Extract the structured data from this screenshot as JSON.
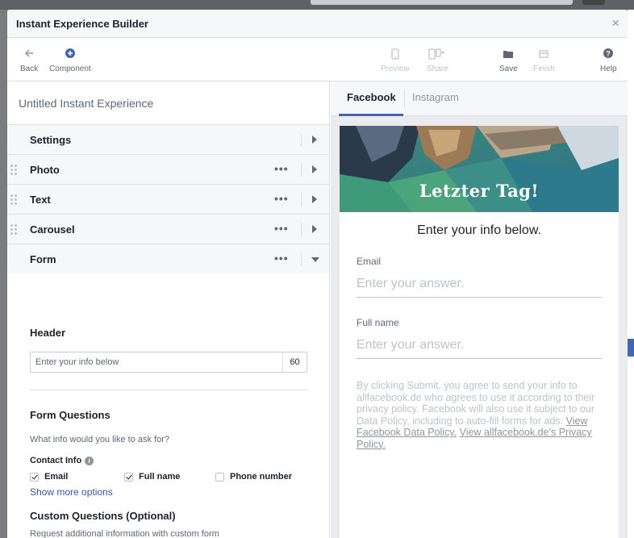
{
  "dialog": {
    "title": "Instant Experience Builder",
    "close_label": "×"
  },
  "toolbar": {
    "back": "Back",
    "component": "Component",
    "preview": "Preview",
    "share": "Share",
    "save": "Save",
    "finish": "Finish",
    "help": "Help",
    "icons": {
      "back": "arrow-left-icon",
      "component": "plus-circle-icon",
      "preview": "phone-icon",
      "share": "share-icon",
      "save": "folder-icon",
      "finish": "flag-icon",
      "help": "help-icon"
    }
  },
  "builder": {
    "experience_title": "Untitled Instant Experience",
    "components": [
      {
        "label": "Settings"
      },
      {
        "label": "Photo"
      },
      {
        "label": "Text"
      },
      {
        "label": "Carousel"
      },
      {
        "label": "Form"
      }
    ]
  },
  "form": {
    "header_title": "Header",
    "header_value": "Enter your info below",
    "header_count": "60",
    "questions_title": "Form Questions",
    "questions_hint": "What info would you like to ask for?",
    "contact_info_label": "Contact Info",
    "contact_info_icon": "i",
    "options": [
      {
        "label": "Email",
        "checked": true
      },
      {
        "label": "Full name",
        "checked": true
      },
      {
        "label": "Phone number",
        "checked": false
      }
    ],
    "show_more": "Show more options",
    "custom_title": "Custom Questions (Optional)",
    "custom_hint": "Request additional information with custom form"
  },
  "preview": {
    "tabs": [
      "Facebook",
      "Instagram"
    ],
    "banner_text": "Letzter Tag!",
    "heading": "Enter your info below.",
    "fields": [
      {
        "label": "Email",
        "placeholder": "Enter your answer."
      },
      {
        "label": "Full name",
        "placeholder": "Enter your answer."
      }
    ],
    "legal_text": "By clicking Submit, you agree to send your info to allfacebook.de who agrees to use it according to their privacy policy. Facebook will also use it subject to our Data Policy, including to auto-fill forms for ads.",
    "legal_link_1": "View Facebook Data Policy.",
    "legal_link_2": "View allfacebook.de's Privacy Policy."
  },
  "colors": {
    "accent": "#4267b2",
    "link": "#365899",
    "panel_bg": "#f6f7f9"
  }
}
